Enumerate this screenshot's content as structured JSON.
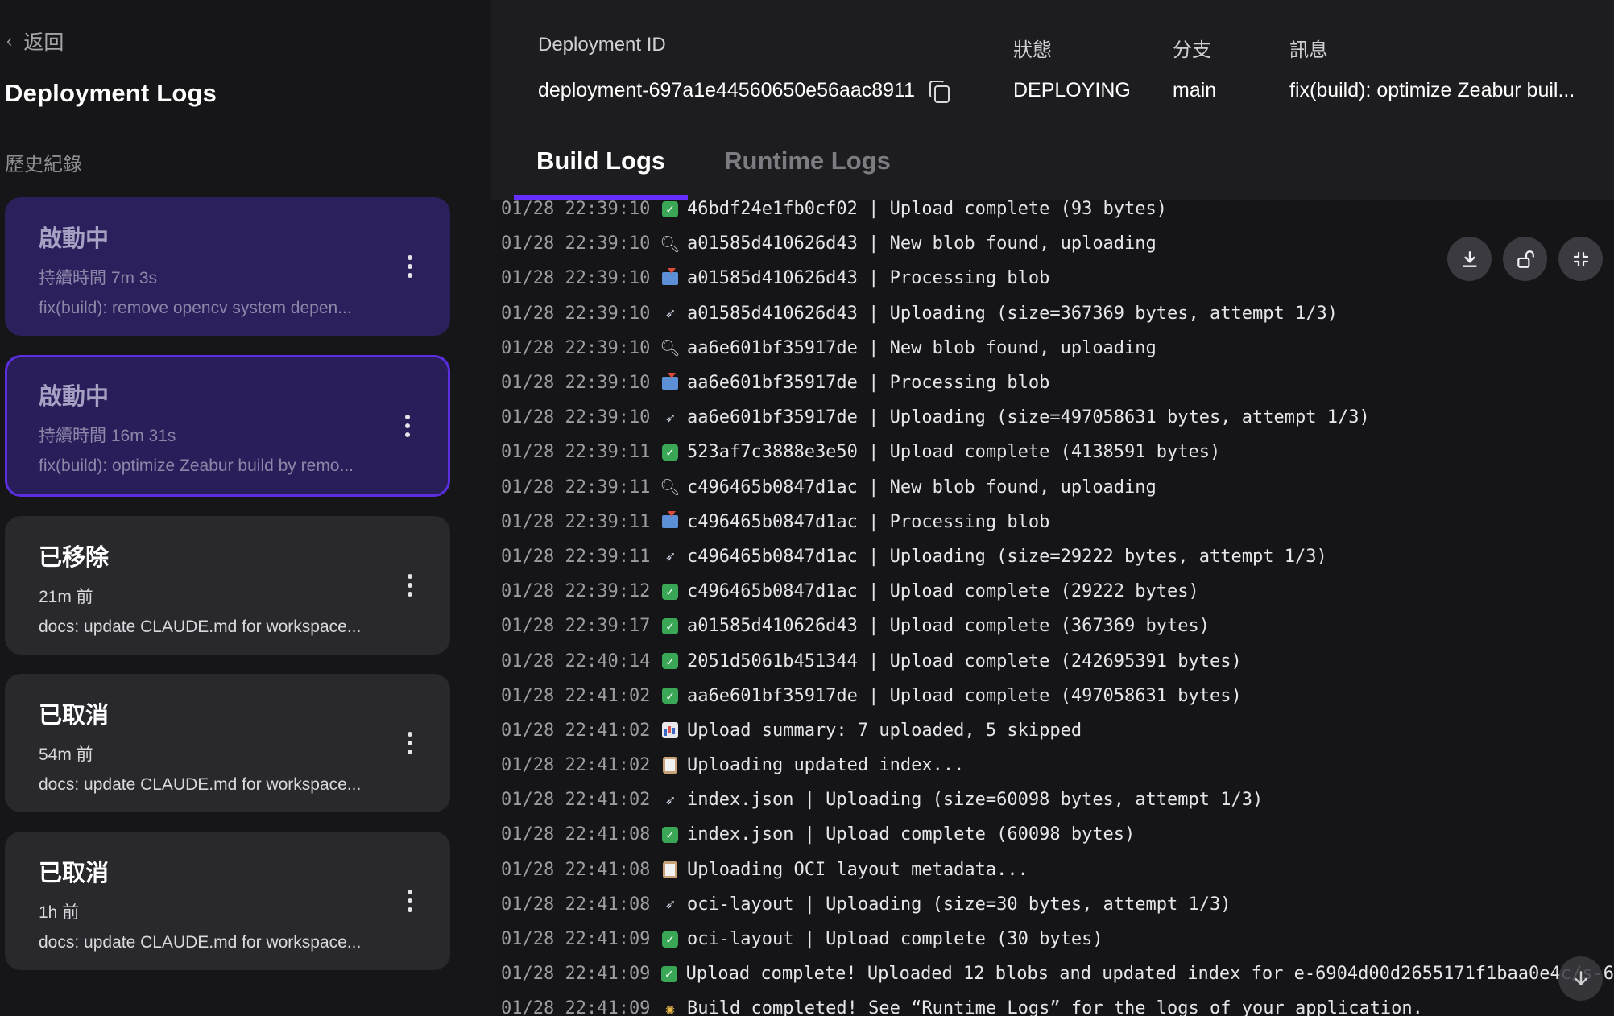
{
  "sidebar": {
    "back_label": "返回",
    "title": "Deployment Logs",
    "history_label": "歷史紀錄",
    "deployments": [
      {
        "status": "啟動中",
        "meta": "持續時間 7m 3s",
        "message": "fix(build): remove opencv system depen...",
        "variant": "purple"
      },
      {
        "status": "啟動中",
        "meta": "持續時間 16m 31s",
        "message": "fix(build): optimize Zeabur build by remo...",
        "variant": "purple-selected"
      },
      {
        "status": "已移除",
        "meta": "21m 前",
        "message": "docs: update CLAUDE.md for workspace...",
        "variant": "gray"
      },
      {
        "status": "已取消",
        "meta": "54m 前",
        "message": "docs: update CLAUDE.md for workspace...",
        "variant": "gray"
      },
      {
        "status": "已取消",
        "meta": "1h 前",
        "message": "docs: update CLAUDE.md for workspace...",
        "variant": "gray"
      }
    ]
  },
  "header": {
    "id_label": "Deployment ID",
    "id_value": "deployment-697a1e44560650e56aac8911",
    "status_label": "狀態",
    "status_value": "DEPLOYING",
    "branch_label": "分支",
    "branch_value": "main",
    "message_label": "訊息",
    "message_value": "fix(build): optimize Zeabur buil..."
  },
  "tabs": {
    "build": "Build Logs",
    "runtime": "Runtime Logs"
  },
  "logs": [
    {
      "ts": "01/28 22:39:10",
      "icon": "check",
      "msg": "46bdf24e1fb0cf02 | Upload complete (93 bytes)"
    },
    {
      "ts": "01/28 22:39:10",
      "icon": "search",
      "msg": "a01585d410626d43 | New blob found, uploading"
    },
    {
      "ts": "01/28 22:39:10",
      "icon": "inbox",
      "msg": "a01585d410626d43 | Processing blob"
    },
    {
      "ts": "01/28 22:39:10",
      "icon": "rocket",
      "msg": "a01585d410626d43 | Uploading (size=367369 bytes, attempt 1/3)"
    },
    {
      "ts": "01/28 22:39:10",
      "icon": "search",
      "msg": "aa6e601bf35917de | New blob found, uploading"
    },
    {
      "ts": "01/28 22:39:10",
      "icon": "inbox",
      "msg": "aa6e601bf35917de | Processing blob"
    },
    {
      "ts": "01/28 22:39:10",
      "icon": "rocket",
      "msg": "aa6e601bf35917de | Uploading (size=497058631 bytes, attempt 1/3)"
    },
    {
      "ts": "01/28 22:39:11",
      "icon": "check",
      "msg": "523af7c3888e3e50 | Upload complete (4138591 bytes)"
    },
    {
      "ts": "01/28 22:39:11",
      "icon": "search",
      "msg": "c496465b0847d1ac | New blob found, uploading"
    },
    {
      "ts": "01/28 22:39:11",
      "icon": "inbox",
      "msg": "c496465b0847d1ac | Processing blob"
    },
    {
      "ts": "01/28 22:39:11",
      "icon": "rocket",
      "msg": "c496465b0847d1ac | Uploading (size=29222 bytes, attempt 1/3)"
    },
    {
      "ts": "01/28 22:39:12",
      "icon": "check",
      "msg": "c496465b0847d1ac | Upload complete (29222 bytes)"
    },
    {
      "ts": "01/28 22:39:17",
      "icon": "check",
      "msg": "a01585d410626d43 | Upload complete (367369 bytes)"
    },
    {
      "ts": "01/28 22:40:14",
      "icon": "check",
      "msg": "2051d5061b451344 | Upload complete (242695391 bytes)"
    },
    {
      "ts": "01/28 22:41:02",
      "icon": "check",
      "msg": "aa6e601bf35917de | Upload complete (497058631 bytes)"
    },
    {
      "ts": "01/28 22:41:02",
      "icon": "chart",
      "msg": "Upload summary: 7 uploaded, 5 skipped"
    },
    {
      "ts": "01/28 22:41:02",
      "icon": "clipboard",
      "msg": "Uploading updated index..."
    },
    {
      "ts": "01/28 22:41:02",
      "icon": "rocket",
      "msg": "index.json | Uploading (size=60098 bytes, attempt 1/3)"
    },
    {
      "ts": "01/28 22:41:08",
      "icon": "check",
      "msg": "index.json | Upload complete (60098 bytes)"
    },
    {
      "ts": "01/28 22:41:08",
      "icon": "clipboard",
      "msg": "Uploading OCI layout metadata..."
    },
    {
      "ts": "01/28 22:41:08",
      "icon": "rocket",
      "msg": "oci-layout | Uploading (size=30 bytes, attempt 1/3)"
    },
    {
      "ts": "01/28 22:41:09",
      "icon": "check",
      "msg": "oci-layout | Upload complete (30 bytes)"
    },
    {
      "ts": "01/28 22:41:09",
      "icon": "check",
      "msg": "Upload complete! Uploaded 12 blobs and updated index for e-6904d00d2655171f1baa0e4c/s-6"
    },
    {
      "ts": "01/28 22:41:09",
      "icon": "party",
      "msg": "Build completed! See “Runtime Logs” for the logs of your application."
    }
  ],
  "toolbar": {
    "download_icon": "download-icon",
    "unlock_icon": "unlock-icon",
    "collapse_icon": "collapse-icon",
    "scroll_icon": "scroll-to-bottom-icon"
  },
  "colors": {
    "accent": "#6530ff",
    "card_purple": "#2b1f5c",
    "card_gray": "#28282d",
    "success": "#3aa757"
  }
}
